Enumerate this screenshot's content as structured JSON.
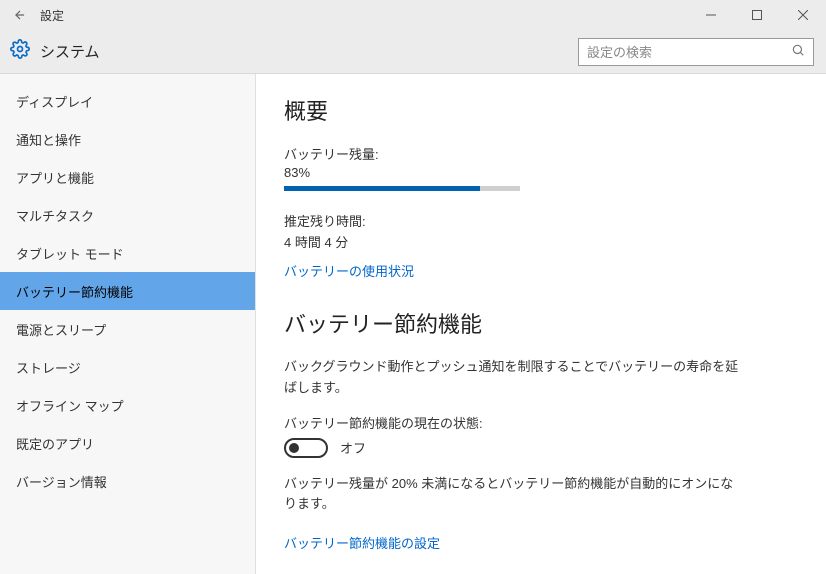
{
  "titlebar": {
    "title": "設定"
  },
  "header": {
    "section_title": "システム",
    "search_placeholder": "設定の検索"
  },
  "sidebar": {
    "items": [
      {
        "label": "ディスプレイ",
        "selected": false
      },
      {
        "label": "通知と操作",
        "selected": false
      },
      {
        "label": "アプリと機能",
        "selected": false
      },
      {
        "label": "マルチタスク",
        "selected": false
      },
      {
        "label": "タブレット モード",
        "selected": false
      },
      {
        "label": "バッテリー節約機能",
        "selected": true
      },
      {
        "label": "電源とスリープ",
        "selected": false
      },
      {
        "label": "ストレージ",
        "selected": false
      },
      {
        "label": "オフライン マップ",
        "selected": false
      },
      {
        "label": "既定のアプリ",
        "selected": false
      },
      {
        "label": "バージョン情報",
        "selected": false
      }
    ]
  },
  "content": {
    "overview_heading": "概要",
    "battery_remaining_label": "バッテリー残量:",
    "battery_remaining_value": "83%",
    "battery_progress_percent": 83,
    "estimated_time_label": "推定残り時間:",
    "estimated_time_value": "4 時間 4 分",
    "battery_usage_link": "バッテリーの使用状況",
    "saver_heading": "バッテリー節約機能",
    "saver_description": "バックグラウンド動作とプッシュ通知を制限することでバッテリーの寿命を延ばします。",
    "saver_state_label": "バッテリー節約機能の現在の状態:",
    "toggle_state": "オフ",
    "auto_on_description": "バッテリー残量が 20% 未満になるとバッテリー節約機能が自動的にオンになります。",
    "saver_settings_link": "バッテリー節約機能の設定"
  }
}
